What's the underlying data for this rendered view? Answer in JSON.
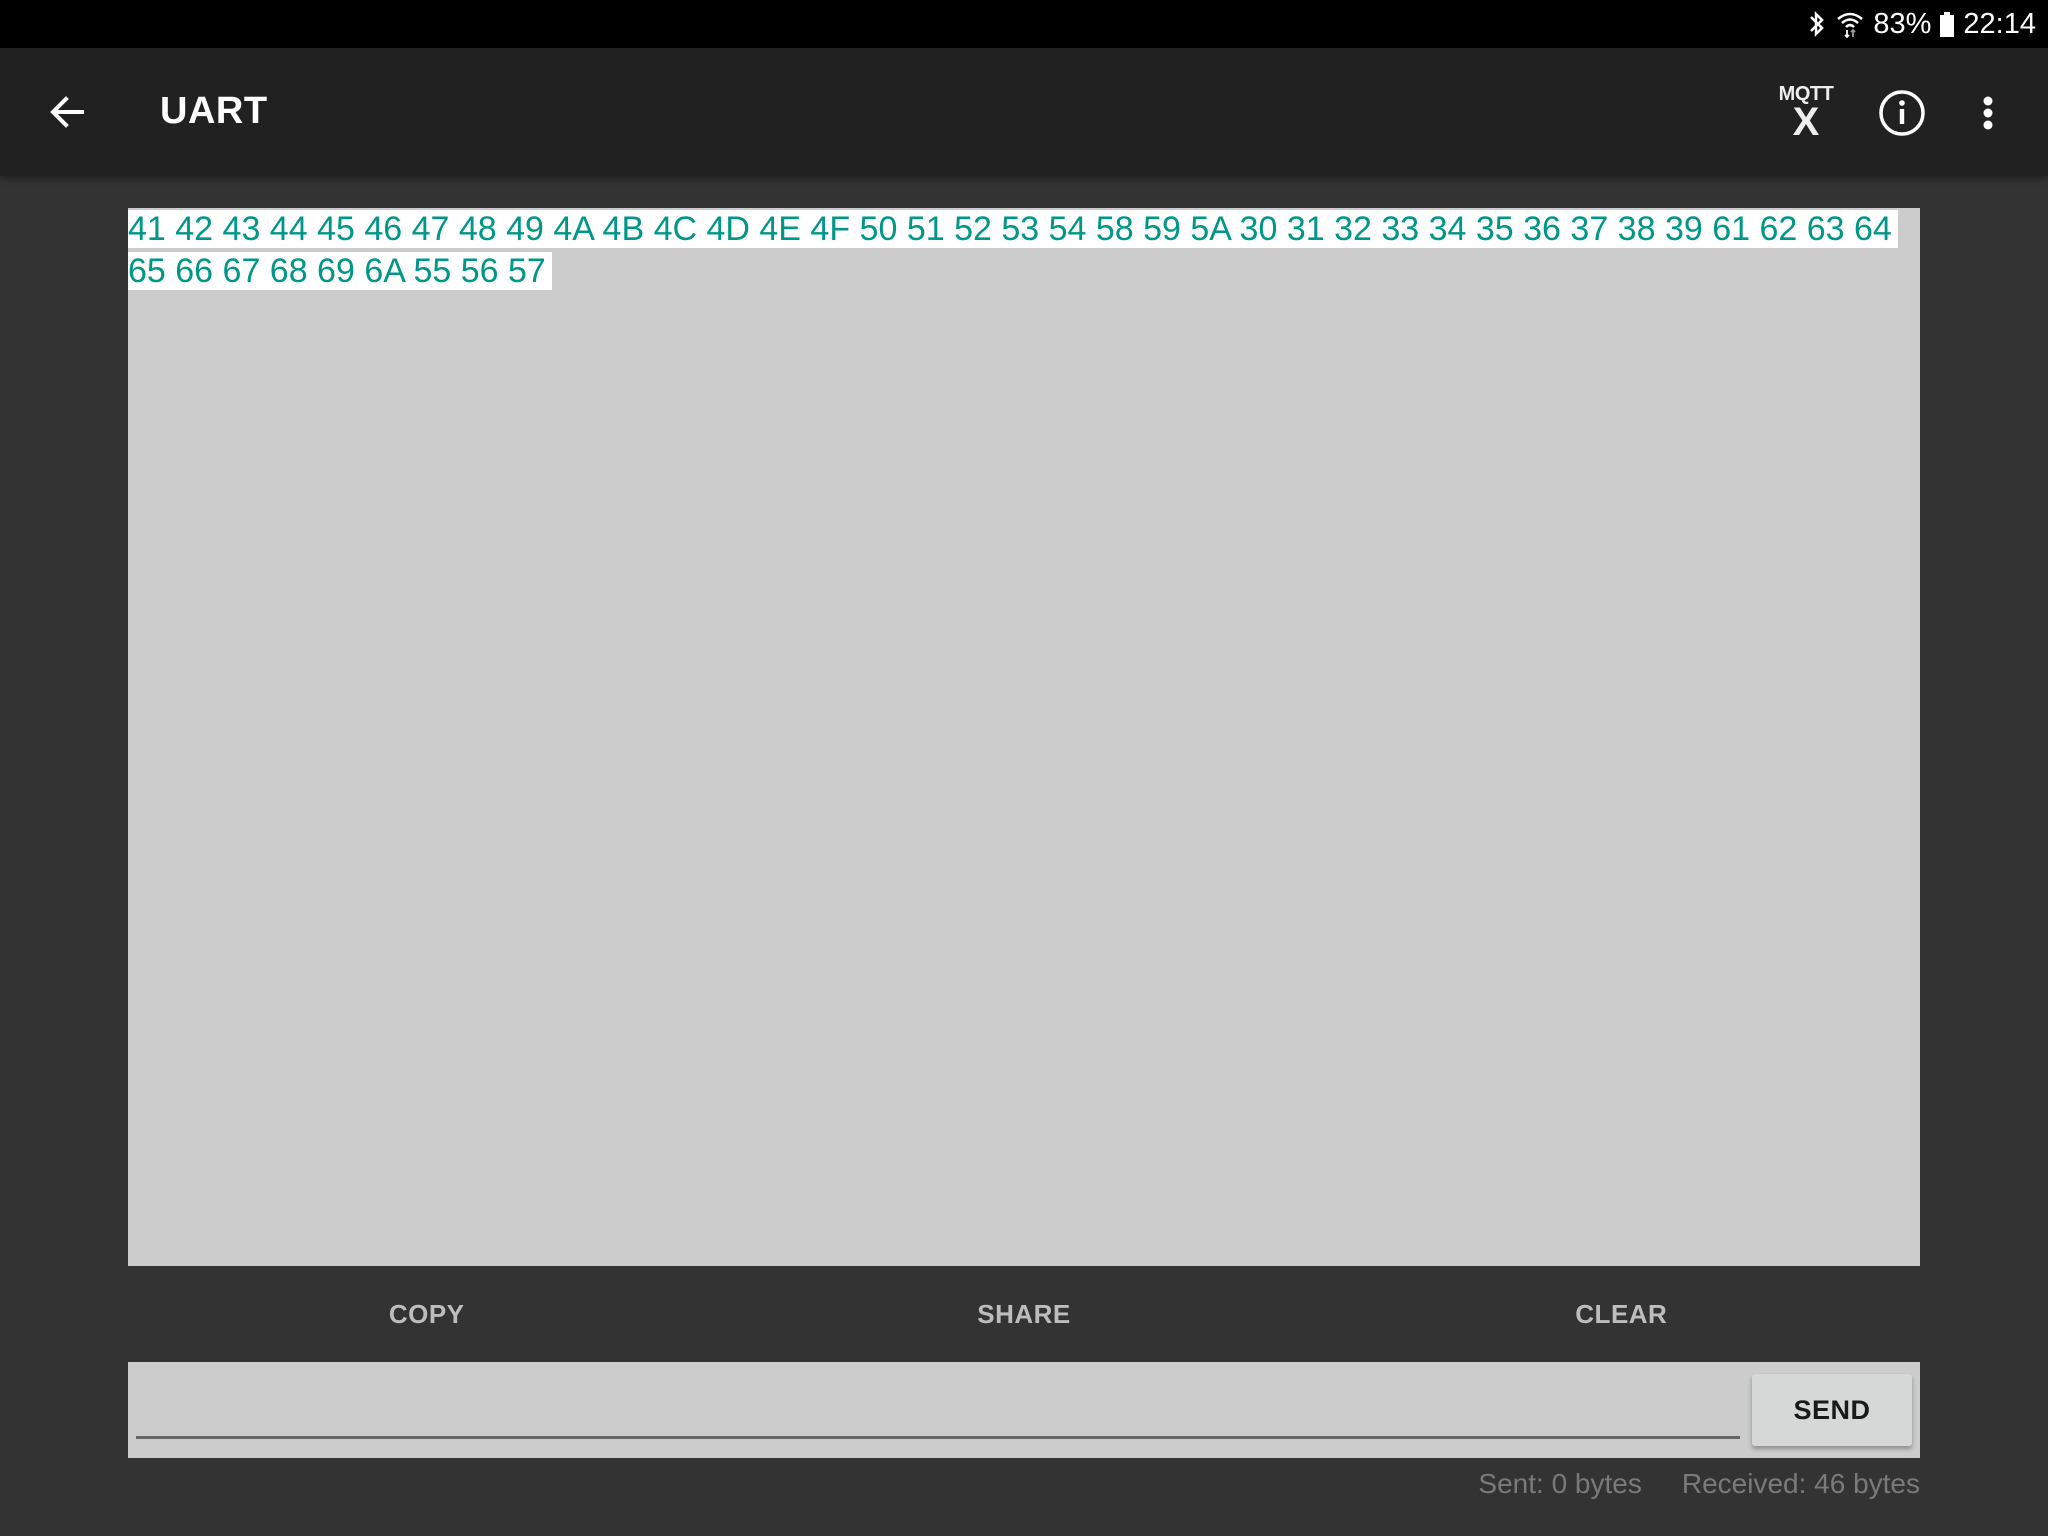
{
  "status_bar": {
    "bluetooth_icon": "bluetooth-icon",
    "wifi_icon": "wifi-icon",
    "battery_percent": "83%",
    "battery_icon": "battery-icon",
    "time": "22:14"
  },
  "app_bar": {
    "back_icon": "arrow-back-icon",
    "title": "UART",
    "actions": {
      "mqtt_top": "MQTT",
      "mqtt_bottom": "X",
      "info_icon": "info-icon",
      "more_icon": "more-vert-icon"
    }
  },
  "received_text": "41 42 43 44 45 46 47 48 49 4A 4B 4C 4D 4E 4F 50 51 52 53 54 58 59 5A 30 31 32 33 34 35 36 37 38 39 61 62 63 64 65 66 67 68 69 6A 55 56 57",
  "actions": {
    "copy": "COPY",
    "share": "SHARE",
    "clear": "CLEAR"
  },
  "send_input": {
    "value": "",
    "placeholder": ""
  },
  "send_button": "SEND",
  "counters": {
    "sent": "Sent: 0 bytes",
    "received": "Received: 46 bytes"
  },
  "colors": {
    "accent_text": "#009688",
    "app_bar": "#212121",
    "background": "#333333",
    "panel": "#cccccc"
  }
}
